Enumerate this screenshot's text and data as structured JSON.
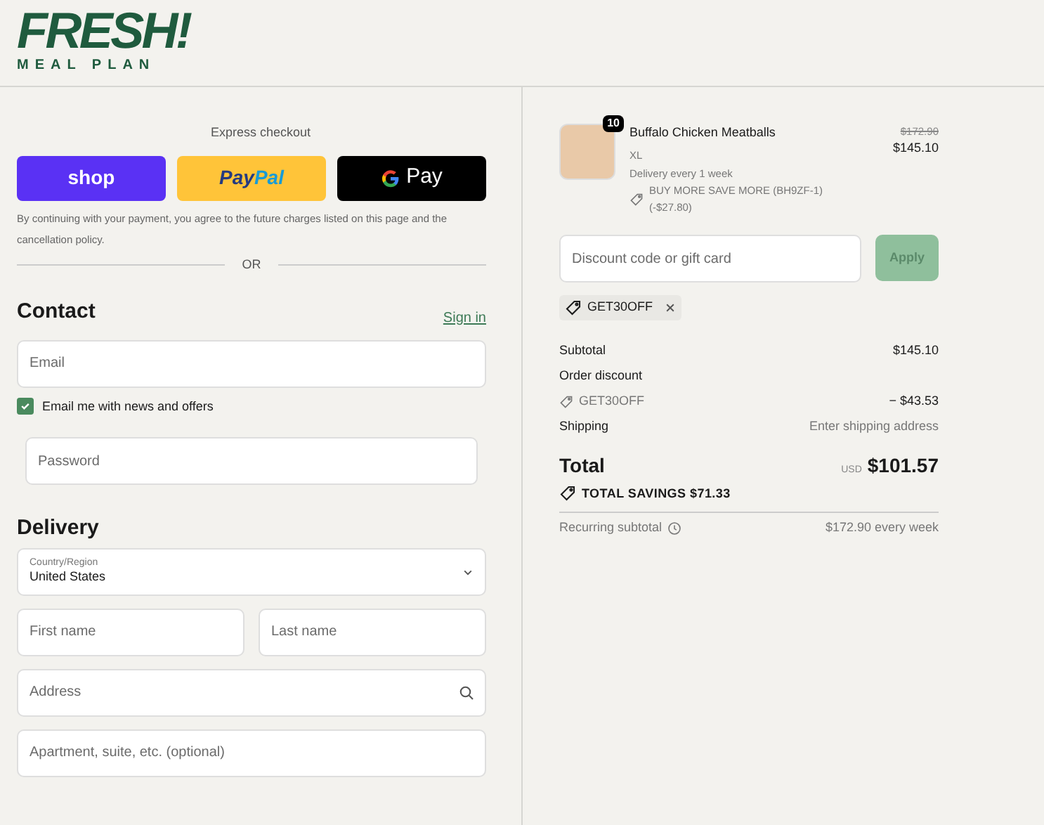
{
  "logo": {
    "title": "FRESH!",
    "subtitle": "MEAL PLAN"
  },
  "express": {
    "title": "Express checkout",
    "buttons": [
      {
        "kind": "shop",
        "label": "shop"
      },
      {
        "kind": "paypal",
        "label": "Pay",
        "label2": "Pal"
      },
      {
        "kind": "gpay",
        "label": "Pay"
      }
    ],
    "note": "By continuing with your payment, you agree to the future charges listed on this page and the cancellation policy.",
    "divider": "OR"
  },
  "contact": {
    "title": "Contact",
    "link": "Sign in",
    "email": {
      "placeholder": "Email"
    },
    "newsletter": {
      "label": "Email me with news and offers",
      "checked": true
    },
    "password": {
      "placeholder": "Password"
    }
  },
  "delivery": {
    "title": "Delivery",
    "country": {
      "label": "Country/Region",
      "value": "United States"
    },
    "first_name": {
      "placeholder": "First name"
    },
    "last_name": {
      "placeholder": "Last name"
    },
    "address": {
      "placeholder": "Address"
    },
    "apartment": {
      "placeholder": "Apartment, suite, etc. (optional)"
    }
  },
  "cart": {
    "items": [
      {
        "quantity": "10",
        "name": "Buffalo Chicken Meatballs",
        "variant": "XL",
        "frequency": "Delivery every 1 week",
        "discount": "BUY MORE SAVE MORE (BH9ZF-1) (-$27.80)",
        "old_price": "$172.90",
        "price": "$145.10"
      }
    ]
  },
  "discount": {
    "placeholder": "Discount code or gift card",
    "button": "Apply",
    "codes": [
      "GET30OFF"
    ]
  },
  "summary": {
    "rows": [
      {
        "kind": "line",
        "label": "Subtotal",
        "value": "$145.10"
      },
      {
        "kind": "line",
        "label": "Order discount"
      },
      {
        "kind": "code",
        "label": "GET30OFF",
        "value": "− $43.53"
      },
      {
        "kind": "muted",
        "label": "Shipping",
        "value": "Enter shipping address"
      }
    ],
    "total": {
      "label": "Total",
      "currency": "USD",
      "value": "$101.57"
    },
    "savings": "TOTAL SAVINGS $71.33",
    "recurring": {
      "label": "Recurring subtotal",
      "value": "$172.90 every week"
    }
  }
}
